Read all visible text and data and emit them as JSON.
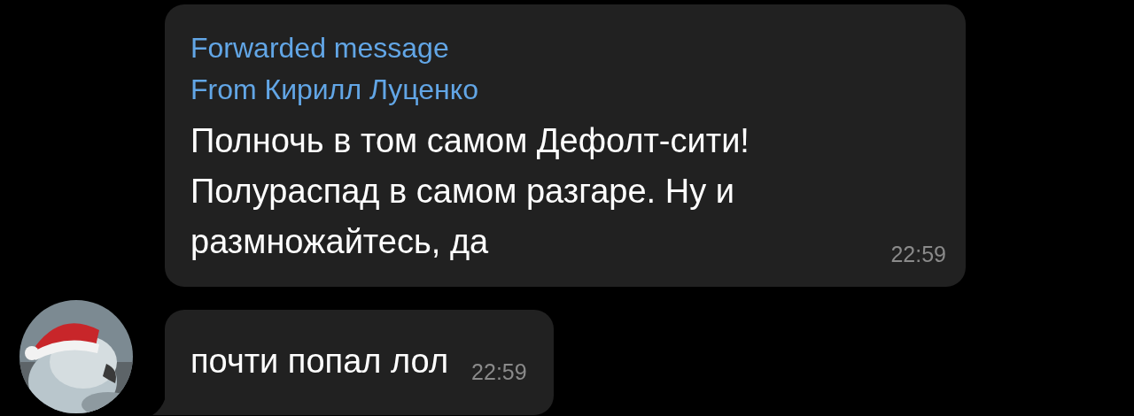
{
  "messages": [
    {
      "forwarded": {
        "label": "Forwarded message",
        "from": "From Кирилл Луценко"
      },
      "text": "Полночь в том самом Дефолт-сити! Полураспад в самом разгаре. Ну и размножайтесь, да",
      "time": "22:59",
      "tail": false
    },
    {
      "text": "почти попал лол",
      "time": "22:59",
      "tail": true
    }
  ]
}
